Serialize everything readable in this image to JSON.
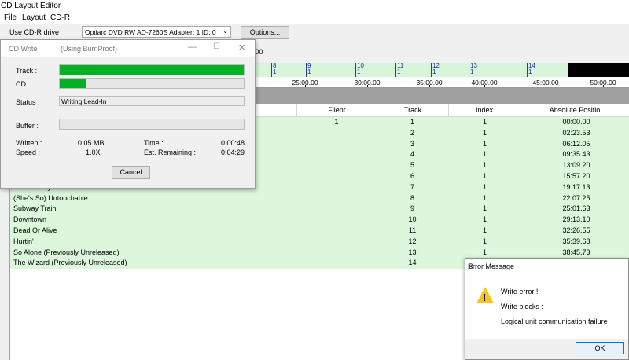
{
  "app": {
    "title": "CD Layout Editor"
  },
  "menu": [
    "File",
    "Layout",
    "CD-R"
  ],
  "toolbar": {
    "drive_label": "Use CD-R drive",
    "drive_value": "Optiarc DVD RW AD-7260S   Adapter: 1  ID: 0",
    "options_label": "Options...",
    "stray_text": ".00"
  },
  "timeline": {
    "marks": [
      {
        "label": "8",
        "sub": "1"
      },
      {
        "label": "9",
        "sub": "1"
      },
      {
        "label": "10",
        "sub": "1"
      },
      {
        "label": "11",
        "sub": "1"
      },
      {
        "label": "12",
        "sub": "1"
      },
      {
        "label": "13",
        "sub": "1"
      },
      {
        "label": "14",
        "sub": "1"
      }
    ],
    "ticks": [
      "25:00.00",
      "30:00.00",
      "35:00.00",
      "40:00.00",
      "45:00.00",
      "50:00.00"
    ]
  },
  "table": {
    "columns": [
      "Filenr",
      "Track",
      "Index",
      "Absolute Positio"
    ],
    "rows": [
      {
        "title": "",
        "filenr": "1",
        "track": "1",
        "index": "1",
        "pos": "00:00.00"
      },
      {
        "title": "",
        "filenr": "",
        "track": "2",
        "index": "1",
        "pos": "02:23.53"
      },
      {
        "title": "",
        "filenr": "",
        "track": "3",
        "index": "1",
        "pos": "06:12.05"
      },
      {
        "title": "",
        "filenr": "",
        "track": "4",
        "index": "1",
        "pos": "09:35.43"
      },
      {
        "title": "",
        "filenr": "",
        "track": "5",
        "index": "1",
        "pos": "13:09.20"
      },
      {
        "title": "",
        "filenr": "",
        "track": "6",
        "index": "1",
        "pos": "15:57.20"
      },
      {
        "title": "London Boys",
        "filenr": "",
        "track": "7",
        "index": "1",
        "pos": "19:17.13"
      },
      {
        "title": "(She's So) Untouchable",
        "filenr": "",
        "track": "8",
        "index": "1",
        "pos": "22:07.25"
      },
      {
        "title": "Subway Train",
        "filenr": "",
        "track": "9",
        "index": "1",
        "pos": "25:01.63"
      },
      {
        "title": "Downtown",
        "filenr": "",
        "track": "10",
        "index": "1",
        "pos": "29:13.10"
      },
      {
        "title": "Dead Or Alive",
        "filenr": "",
        "track": "11",
        "index": "1",
        "pos": "32:26.55"
      },
      {
        "title": "Hurtin'",
        "filenr": "",
        "track": "12",
        "index": "1",
        "pos": "35:39.68"
      },
      {
        "title": "So Alone (Previously Unreleased)",
        "filenr": "",
        "track": "13",
        "index": "1",
        "pos": "38:45.73"
      },
      {
        "title": "The Wizard (Previously Unreleased)",
        "filenr": "",
        "track": "14",
        "index": "1",
        "pos": ""
      }
    ]
  },
  "cdwrite": {
    "title": "CD Write",
    "subtitle": "(Using BurnProof)",
    "track_label": "Track :",
    "cd_label": "CD :",
    "status_label": "Status :",
    "status_value": "Writing Lead-In",
    "buffer_label": "Buffer :",
    "written_label": "Written :",
    "written_value": "0.05 MB",
    "speed_label": "Speed :",
    "speed_value": "1.0X",
    "time_label": "Time :",
    "time_value": "0:00:48",
    "remaining_label": "Est. Remaining :",
    "remaining_value": "0:04:29",
    "cancel_label": "Cancel",
    "track_progress": 1.0,
    "cd_progress": 0.14,
    "buffer_progress": 0.0
  },
  "error": {
    "title": "Error Message",
    "line1": "Write error !",
    "line2": "Write blocks :",
    "line3": "Logical unit communication failure",
    "ok_label": "OK"
  },
  "colors": {
    "progress": "#06b025",
    "row_bg": "#dcf7dc",
    "accent": "#0078d7"
  }
}
